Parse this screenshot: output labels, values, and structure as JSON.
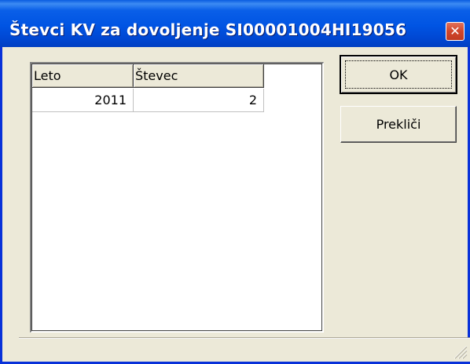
{
  "window": {
    "title": "Števci KV za dovoljenje SI00001004HI19056",
    "close_glyph": "✕"
  },
  "grid": {
    "columns": [
      "Leto",
      "Števec"
    ],
    "rows": [
      [
        "2011",
        "2"
      ]
    ]
  },
  "buttons": {
    "ok_label": "OK",
    "cancel_label": "Prekliči"
  },
  "colors": {
    "titlebar": "#0054e3",
    "window_frame": "#0831d9",
    "dialog_bg": "#ece9d8",
    "close_button": "#d0452b"
  },
  "icons": {
    "close": "close-icon",
    "resize_grip": "resize-grip-icon"
  }
}
